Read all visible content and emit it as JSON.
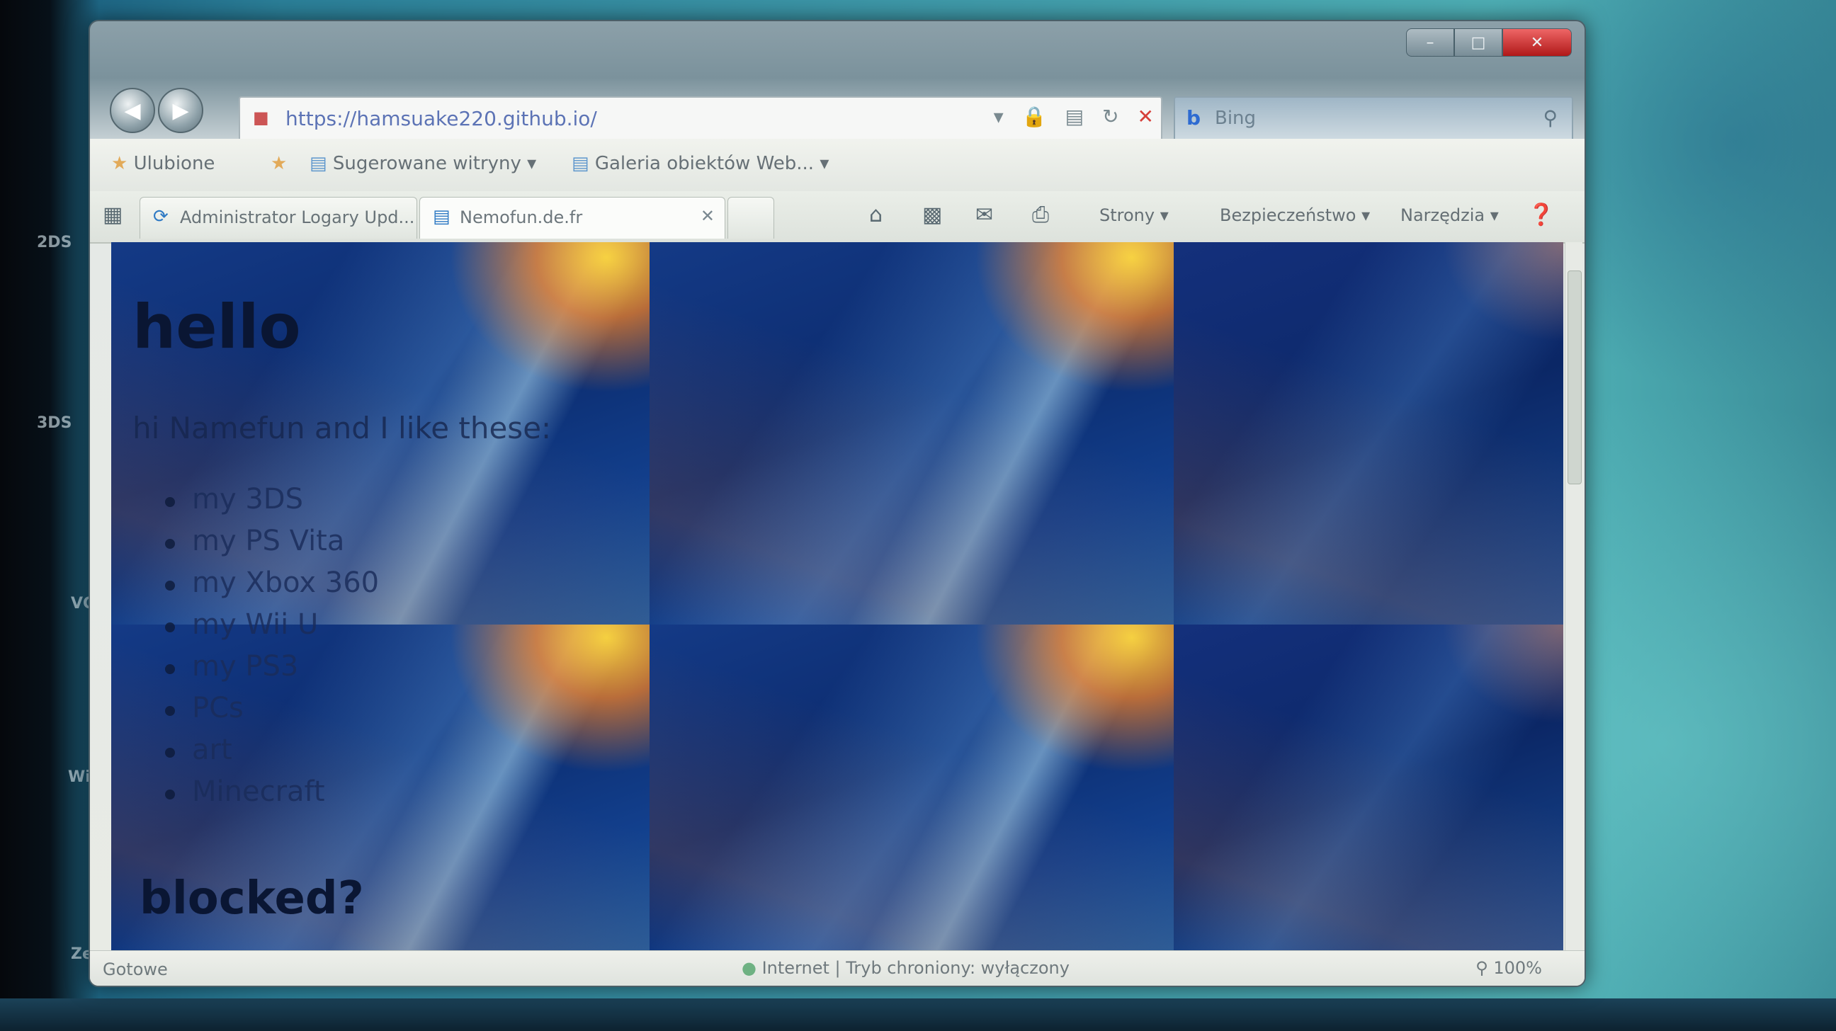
{
  "window": {
    "title": "",
    "controls": {
      "minimize": "–",
      "maximize": "□",
      "close": "✕"
    }
  },
  "nav": {
    "back_glyph": "◀",
    "forward_glyph": "▶",
    "url": "https://hamsuake220.github.io/",
    "search_logo": "b",
    "search_placeholder": "Bing"
  },
  "favorites": {
    "favorites_label": "Ulubione",
    "suggested_sites": "Sugerowane witryny ▾",
    "web_slices": "Galeria obiektów Web... ▾"
  },
  "tabs": [
    {
      "label": "Administrator Logary Upd..."
    },
    {
      "label": "Nemofun.de.fr"
    }
  ],
  "commands": {
    "page": "Strony ▾",
    "safety": "Bezpieczeństwo ▾",
    "tools": "Narzędzia ▾",
    "help": "▾"
  },
  "page": {
    "heading": "hello",
    "intro": "hi Namefun and I like these:",
    "likes": [
      "my 3DS",
      "my PS Vita",
      "my Xbox 360",
      "my Wii U",
      "my PS3",
      "PCs",
      "art",
      "Minecraft"
    ],
    "heading2": "blocked?"
  },
  "status": {
    "left": "Gotowe",
    "zone": "Internet | Tryb chroniony: wyłączony",
    "zoom": "100%"
  },
  "icons": {
    "favorites": "star-icon",
    "page": "page-icon",
    "print": "printer-icon",
    "rss": "feed-icon",
    "mail": "mail-icon",
    "home": "home-icon",
    "help": "help-icon"
  }
}
